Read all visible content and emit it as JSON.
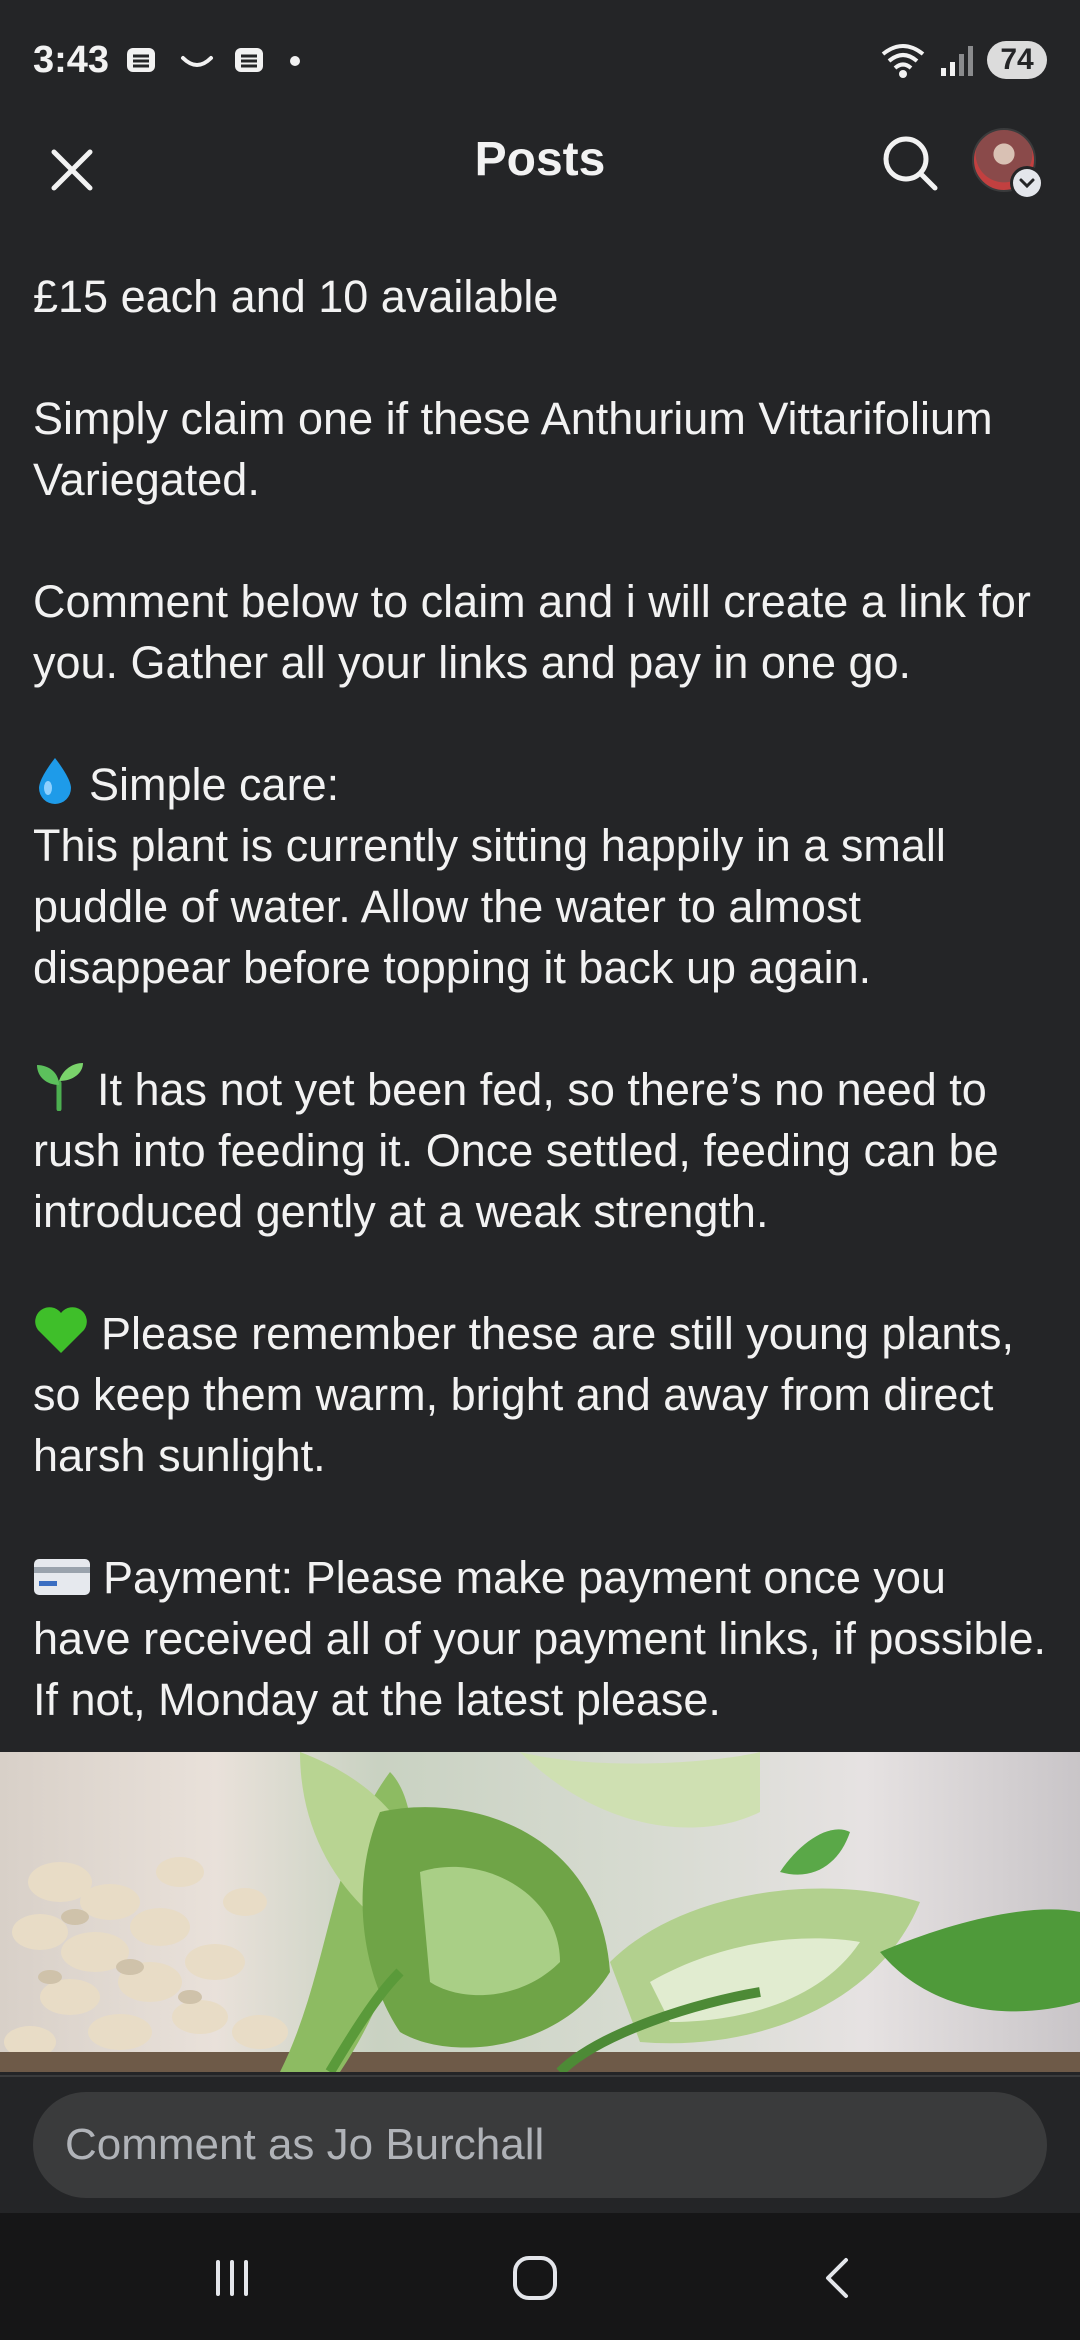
{
  "status_bar": {
    "time": "3:43",
    "battery": "74",
    "icons": [
      "stack-icon",
      "smile-icon",
      "stack-icon",
      "dot-icon",
      "wifi-icon",
      "signal-icon",
      "battery-icon"
    ]
  },
  "header": {
    "title": "Posts",
    "icons": [
      "close-icon",
      "search-icon",
      "avatar",
      "chevron-down-icon"
    ]
  },
  "post": {
    "paragraphs": {
      "p1": "£15 each and 10 available",
      "p2": "Simply claim one if these Anthurium Vittarifolium Variegated.",
      "p3": "Comment below to claim and i will create a link for you. Gather all your links and pay in one go.",
      "p4_heading": "Simple care:",
      "p4_body": "This plant is currently sitting happily in a small puddle of water. Allow the water to almost disappear before topping it back up again.",
      "p5": "It has not yet been fed, so there’s no need to rush into feeding it. Once settled, feeding can be introduced gently at a weak strength.",
      "p6": "Please remember these are still young plants, so keep them warm, bright and away from direct harsh sunlight.",
      "p7": "Payment: Please make payment once you have received all of your payment links, if possible. If not, Monday at the latest please."
    },
    "emoji": [
      "droplet-icon",
      "seedling-icon",
      "green-heart-icon",
      "credit-card-icon"
    ]
  },
  "comment": {
    "placeholder": "Comment as Jo Burchall"
  },
  "nav": {
    "icons": [
      "recent-apps-icon",
      "home-icon",
      "back-icon"
    ]
  }
}
